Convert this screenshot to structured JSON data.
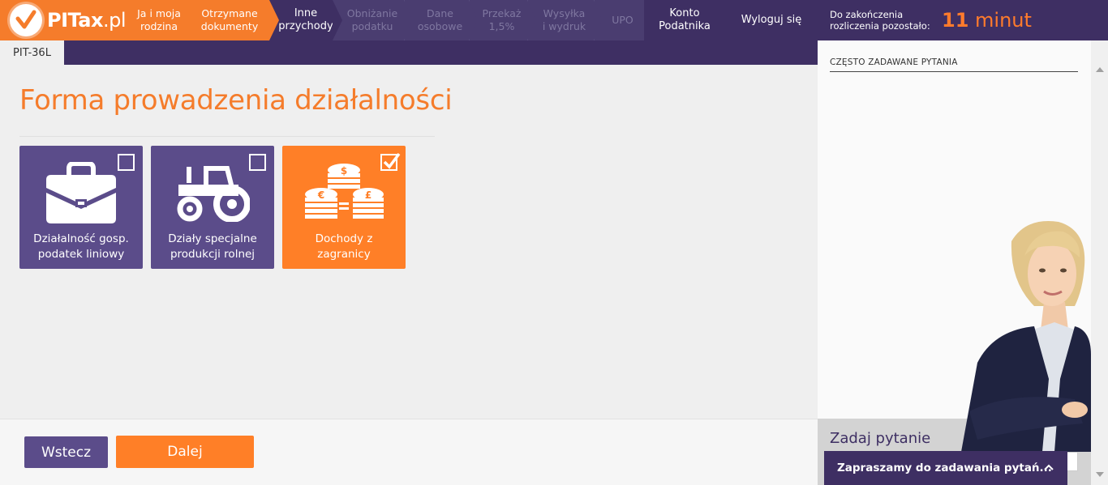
{
  "header": {
    "logo": {
      "brand": "PITax",
      "suffix": ".pl"
    },
    "steps": [
      {
        "label_line1": "Ja i moja",
        "label_line2": "rodzina",
        "state": "done"
      },
      {
        "label_line1": "Otrzymane",
        "label_line2": "dokumenty",
        "state": "done"
      },
      {
        "label_line1": "Inne",
        "label_line2": "przychody",
        "state": "active"
      },
      {
        "label_line1": "Obniżanie",
        "label_line2": "podatku",
        "state": "inactive"
      },
      {
        "label_line1": "Dane",
        "label_line2": "osobowe",
        "state": "inactive"
      },
      {
        "label_line1": "Przekaż",
        "label_line2": "1,5%",
        "state": "inactive"
      },
      {
        "label_line1": "Wysyłka",
        "label_line2": "i wydruk",
        "state": "inactive"
      },
      {
        "label_line1": "UPO",
        "label_line2": "",
        "state": "inactive"
      }
    ],
    "account_line1": "Konto",
    "account_line2": "Podatnika",
    "logout": "Wyloguj się",
    "timer_label_line1": "Do zakończenia",
    "timer_label_line2": "rozliczenia pozostało:",
    "timer_number": "11",
    "timer_unit": "minut"
  },
  "form_tab": "PIT-36L",
  "main": {
    "title": "Forma prowadzenia działalności",
    "tiles": [
      {
        "label_line1": "Działalność gosp.",
        "label_line2": "podatek liniowy",
        "checked": false,
        "icon": "briefcase-icon"
      },
      {
        "label_line1": "Działy specjalne",
        "label_line2": "produkcji rolnej",
        "checked": false,
        "icon": "tractor-icon"
      },
      {
        "label_line1": "Dochody z zagranicy",
        "label_line2": "",
        "checked": true,
        "icon": "coins-icon"
      }
    ],
    "back_label": "Wstecz",
    "next_label": "Dalej"
  },
  "side": {
    "faq_title": "CZĘSTO ZADAWANE PYTANIA",
    "ask_title": "Zadaj pytanie",
    "ask_bar": "Zapraszamy do zadawania pytań..."
  },
  "colors": {
    "purple": "#3e2f63",
    "tile_purple": "#5b4c8a",
    "orange": "#ff7f27"
  }
}
